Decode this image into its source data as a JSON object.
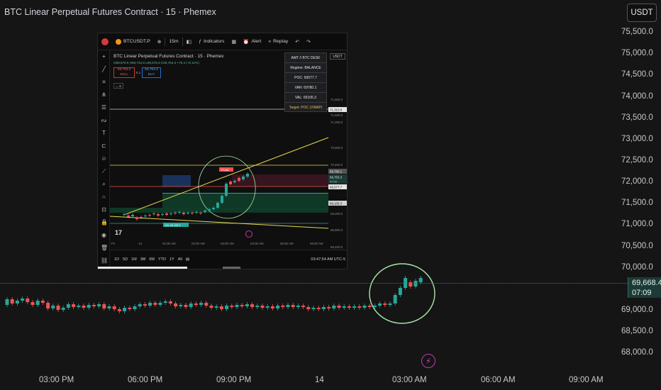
{
  "window": {
    "title": "BTC Linear Perpetual Futures Contract · 15 · Phemex",
    "currency_button": "USDT"
  },
  "colors": {
    "background": "#151515",
    "up": "#26a69a",
    "down": "#ef5350",
    "highlight_circle": "#a8e6a8",
    "price_line": "#2f7e70"
  },
  "price_axis": {
    "labels": [
      "75,500.0",
      "75,000.0",
      "74,500.0",
      "74,000.0",
      "73,500.0",
      "73,000.0",
      "72,500.0",
      "72,000.0",
      "71,500.0",
      "71,000.0",
      "70,500.0",
      "70,000.0",
      "69,000.0",
      "68,500.0",
      "68,000.0"
    ],
    "current_price": "69,668.4",
    "countdown": "07:09"
  },
  "time_axis": {
    "labels": [
      "03:00 PM",
      "06:00 PM",
      "09:00 PM",
      "14",
      "03:00 AM",
      "06:00 AM",
      "09:00 AM"
    ]
  },
  "event_icon": "lightning-icon",
  "inset": {
    "toolbar": {
      "symbol": "BTCUSDT.P",
      "interval": "15m",
      "indicators": "Indicators",
      "alert": "Alert",
      "replay": "Replay"
    },
    "title": "BTC Linear Perpetual Futures Contract · 15 · Phemex",
    "subtitle": "O69,676.9 H69,743.6 L69,676.6 C69,753.3 +76.4 (+0.11%)",
    "sell": {
      "price": "69,753.2",
      "label": "SELL"
    },
    "buy": {
      "price": "69,753.3",
      "label": "BUY"
    },
    "spread": "0.1",
    "indicator_count": "5",
    "amt_panel": {
      "rows": [
        "AMT // BTC DESK",
        "Regime: BALANCE",
        "POC: 69577.7",
        "VAH: 69780.1",
        "VAL: 69105.3",
        "Target: POC (VWAP)"
      ]
    },
    "currency": "USDT",
    "price_labels": [
      "71,600.0",
      "71,400.0",
      "71,200.0",
      "70,800.0",
      "70,400.0",
      "70,000.0",
      "69,200.0",
      "68,800.0",
      "68,400.0",
      "68,000.0"
    ],
    "price_tags": [
      "71,310.8",
      "69,780.1",
      "69,753.3",
      "69,577.7",
      "69,105.3"
    ],
    "price_tag_countdown": "07:09",
    "trade_label": "PLAN",
    "band_label": "VAL 69,105.3",
    "time_labels": [
      "Fri",
      "14",
      "01:00 AM",
      "02:00 AM",
      "03:00 AM",
      "04:00 AM",
      "05:00 AM",
      "06:00 AM"
    ],
    "timeframes": [
      "1D",
      "5D",
      "1M",
      "3M",
      "6M",
      "YTD",
      "1Y",
      "All"
    ],
    "clock": "03:47:54 AM UTC-5"
  }
}
